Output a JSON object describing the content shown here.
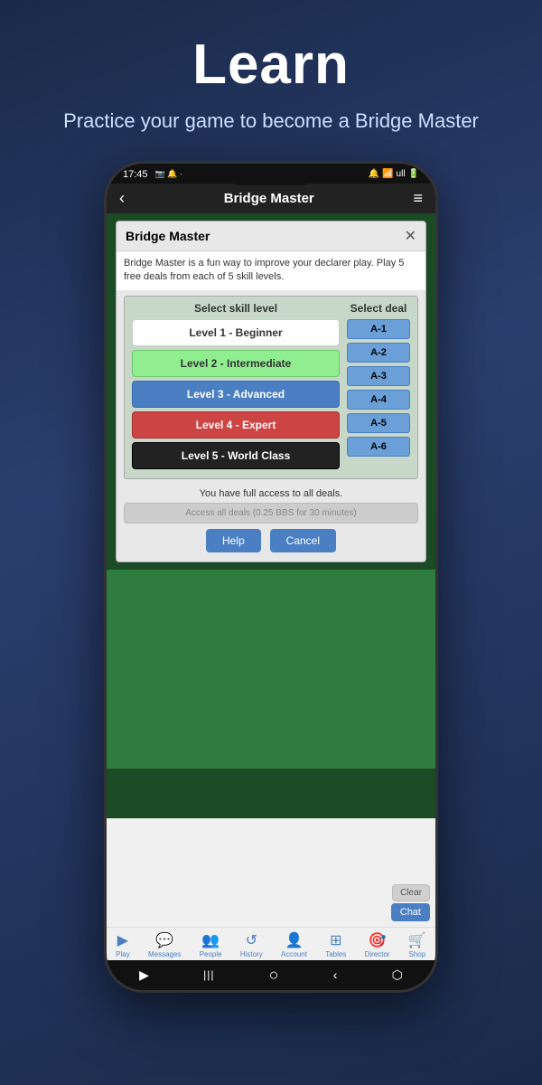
{
  "page": {
    "hero_title": "Learn",
    "hero_subtitle": "Practice your game to\nbecome a Bridge Master"
  },
  "status_bar": {
    "time": "17:45",
    "icons_left": "📷 🔔 ·",
    "icons_right": "🔔 WiFi ull 🔋"
  },
  "nav": {
    "back_icon": "‹",
    "title": "Bridge Master",
    "menu_icon": "≡"
  },
  "dialog": {
    "title": "Bridge Master",
    "close_icon": "✕",
    "description": "Bridge Master is a fun way to improve your declarer play. Play 5 free deals from each of 5 skill levels.",
    "skill_col_header": "Select skill level",
    "deal_col_header": "Select deal",
    "skill_levels": [
      {
        "label": "Level 1 - Beginner",
        "style": "white"
      },
      {
        "label": "Level 2 - Intermediate",
        "style": "green"
      },
      {
        "label": "Level 3 - Advanced",
        "style": "blue"
      },
      {
        "label": "Level 4 - Expert",
        "style": "red"
      },
      {
        "label": "Level 5 - World Class",
        "style": "black"
      }
    ],
    "deals": [
      "A-1",
      "A-2",
      "A-3",
      "A-4",
      "A-5",
      "A-6"
    ],
    "full_access_text": "You have full access to all deals.",
    "access_btn_label": "Access all deals (0.25 BBS for 30 minutes)",
    "help_btn": "Help",
    "cancel_btn": "Cancel"
  },
  "bottom_nav": {
    "items": [
      {
        "icon": "▶",
        "label": "Play"
      },
      {
        "icon": "💬",
        "label": "Messages"
      },
      {
        "icon": "👥",
        "label": "People"
      },
      {
        "icon": "↺",
        "label": "History"
      },
      {
        "icon": "👤",
        "label": "Account"
      },
      {
        "icon": "⊞",
        "label": "Tables"
      },
      {
        "icon": "🎯",
        "label": "Director"
      },
      {
        "icon": "🛒",
        "label": "Shop"
      }
    ]
  },
  "system_nav": {
    "back": "‹",
    "home": "○",
    "recents": "|||",
    "extra": "⬡"
  },
  "action_buttons": {
    "clear_label": "Clear",
    "chat_label": "Chat"
  }
}
